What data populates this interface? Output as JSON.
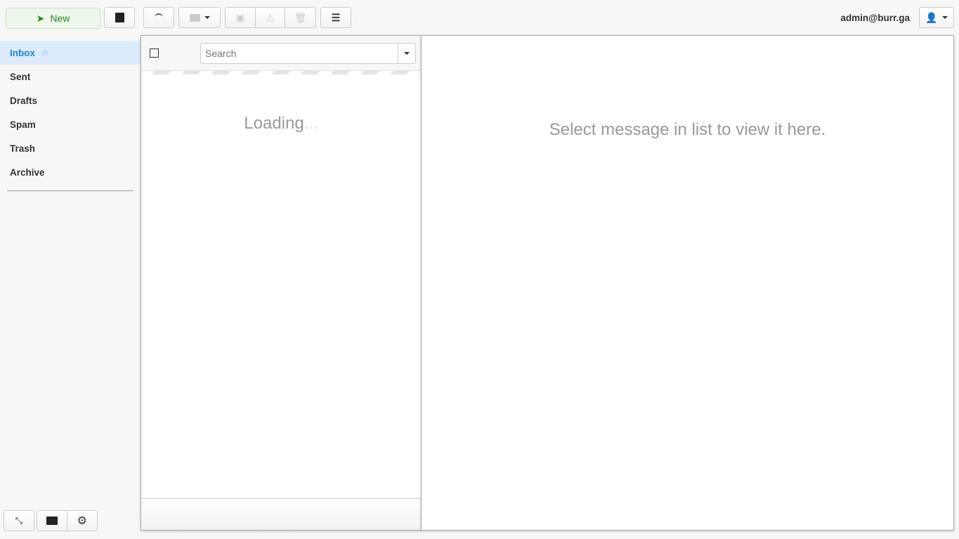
{
  "toolbar": {
    "new_label": "New",
    "user_email": "admin@burr.ga"
  },
  "folders": [
    {
      "label": "Inbox",
      "active": true
    },
    {
      "label": "Sent"
    },
    {
      "label": "Drafts"
    },
    {
      "label": "Spam"
    },
    {
      "label": "Trash"
    },
    {
      "label": "Archive"
    }
  ],
  "list": {
    "search_placeholder": "Search",
    "loading": "Loading",
    "loading_dots": "..."
  },
  "preview": {
    "empty_text": "Select message in list to view it here."
  },
  "colors": {
    "accent": "#1a88d4",
    "active_bg": "#dcecfc",
    "new_text": "#1e8a1e"
  }
}
